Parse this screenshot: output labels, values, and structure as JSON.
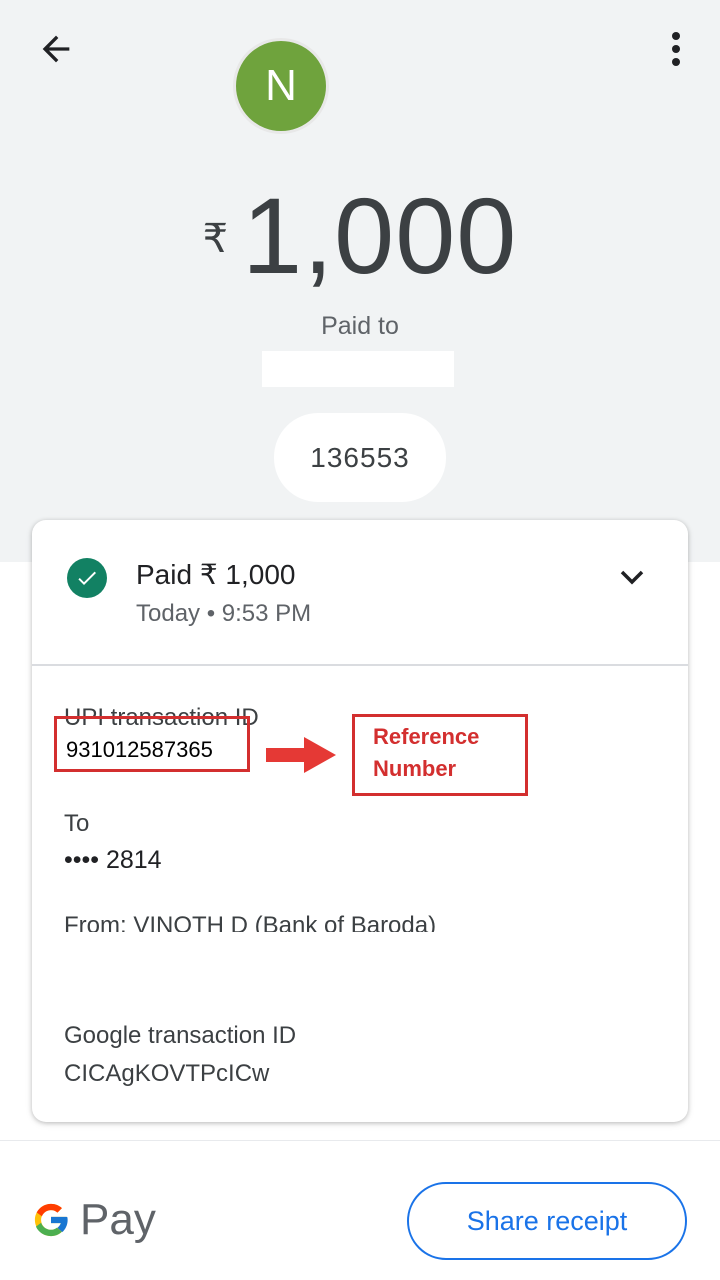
{
  "header": {
    "back_icon": "arrow-back-icon",
    "menu_icon": "more-vert-icon",
    "avatar_initial": "N",
    "avatar_color": "#6fa33d"
  },
  "payment": {
    "currency_symbol": "₹",
    "amount": "1,000",
    "paid_to_label": "Paid to",
    "note": "136553"
  },
  "status": {
    "title": "Paid ₹ 1,000",
    "time": "Today • 9:53 PM",
    "status_color": "#128163"
  },
  "details": {
    "upi_label": "UPI transaction ID",
    "upi_value": "931012587365",
    "to_label": "To",
    "to_value": "•••• 2814",
    "from_label": "From: VINOTH D (Bank of Baroda)",
    "google_label": "Google transaction ID",
    "google_value": "CICAgKOVTPcICw"
  },
  "annotation": {
    "reference_label": "Reference Number",
    "annotation_color": "#d32f2f"
  },
  "footer": {
    "brand": "Pay",
    "share_label": "Share receipt",
    "accent": "#1a73e8"
  }
}
